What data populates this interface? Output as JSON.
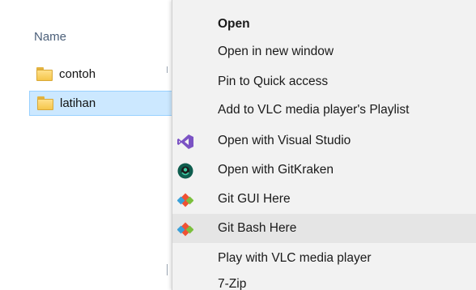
{
  "explorer": {
    "column_header": "Name",
    "files": [
      {
        "name": "contoh",
        "selected": false
      },
      {
        "name": "latihan",
        "selected": true
      }
    ]
  },
  "context_menu": {
    "items": [
      {
        "label": "Open",
        "icon": null,
        "bold": true
      },
      {
        "label": "Open in new window",
        "icon": null
      },
      {
        "label": "Pin to Quick access",
        "icon": null
      },
      {
        "label": "Add to VLC media player's Playlist",
        "icon": null
      },
      {
        "label": "Open with Visual Studio",
        "icon": "visual-studio-icon"
      },
      {
        "label": "Open with GitKraken",
        "icon": "gitkraken-icon"
      },
      {
        "label": "Git GUI Here",
        "icon": "git-icon"
      },
      {
        "label": "Git Bash Here",
        "icon": "git-icon",
        "highlighted": true
      },
      {
        "label": "Play with VLC media player",
        "icon": null
      },
      {
        "label": "7-Zip",
        "icon": null
      }
    ]
  },
  "colors": {
    "selection_bg": "#cce8ff",
    "menu_bg": "#f2f2f2",
    "menu_hover": "#e5e5e5",
    "visual_studio": "#7b53c4",
    "gitkraken": "#0f5d4e",
    "git": "#f05133"
  }
}
